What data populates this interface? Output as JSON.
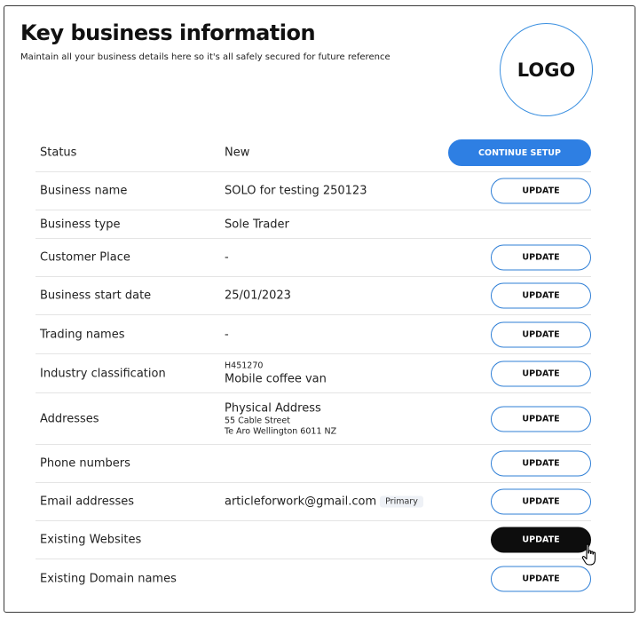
{
  "header": {
    "title": "Key business information",
    "subtitle": "Maintain all your business details here so it's all safely secured for future reference",
    "logo_text": "LOGO"
  },
  "colors": {
    "accent": "#2e7fe3",
    "dark_button": "#0d0d0d",
    "border": "#e4e4e4"
  },
  "rows": [
    {
      "label": "Status",
      "value": "New",
      "button": "CONTINUE SETUP"
    },
    {
      "label": "Business name",
      "value": "SOLO for testing 250123",
      "button": "UPDATE"
    },
    {
      "label": "Business type",
      "value": "Sole Trader"
    },
    {
      "label": "Customer Place",
      "value": "-",
      "button": "UPDATE"
    },
    {
      "label": "Business start date",
      "value": "25/01/2023",
      "button": "UPDATE"
    },
    {
      "label": "Trading names",
      "value": "-",
      "button": "UPDATE"
    },
    {
      "label": "Industry classification",
      "code": "H451270",
      "value": "Mobile coffee van",
      "button": "UPDATE"
    },
    {
      "label": "Addresses",
      "value": "Physical Address",
      "line1": "55 Cable Street",
      "line2": "Te Aro Wellington 6011 NZ",
      "button": "UPDATE"
    },
    {
      "label": "Phone numbers",
      "button": "UPDATE"
    },
    {
      "label": "Email addresses",
      "value": "articleforwork@gmail.com",
      "badge": "Primary",
      "button": "UPDATE"
    },
    {
      "label": "Existing Websites",
      "button": "UPDATE"
    },
    {
      "label": "Existing Domain names",
      "button": "UPDATE"
    }
  ]
}
